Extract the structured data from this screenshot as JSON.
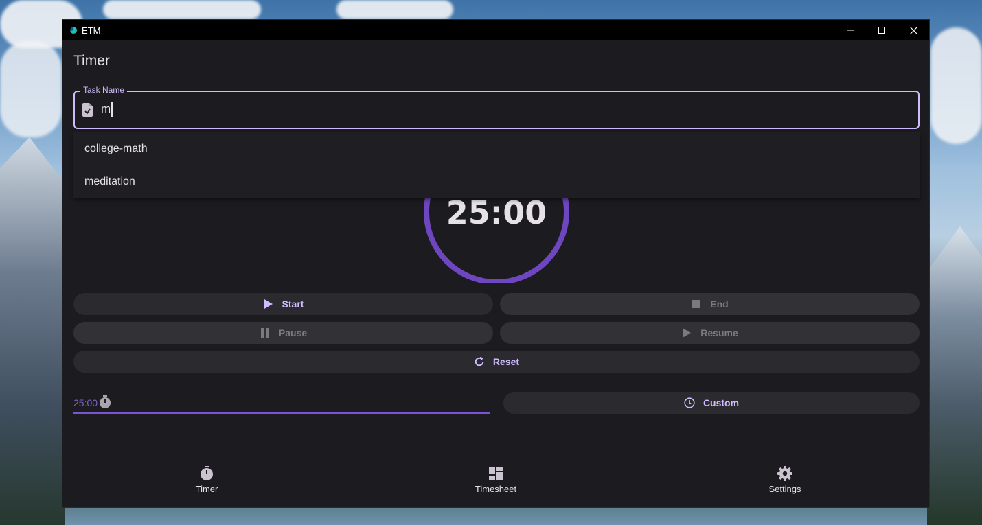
{
  "window": {
    "app_title": "ETM"
  },
  "page": {
    "title": "Timer"
  },
  "task_field": {
    "label": "Task Name",
    "value": "m"
  },
  "suggestions": [
    "college-math",
    "meditation"
  ],
  "timer": {
    "display": "25:00",
    "ring_color": "#6e46c0",
    "progress": 1.0
  },
  "buttons": {
    "start": "Start",
    "end": "End",
    "pause": "Pause",
    "resume": "Resume",
    "reset": "Reset",
    "custom": "Custom"
  },
  "duration_field": {
    "value": "25:00"
  },
  "nav": {
    "timer": "Timer",
    "timesheet": "Timesheet",
    "settings": "Settings"
  },
  "colors": {
    "accent": "#d0bcff",
    "surface": "#1c1b1f",
    "button": "#2b2a2f"
  }
}
